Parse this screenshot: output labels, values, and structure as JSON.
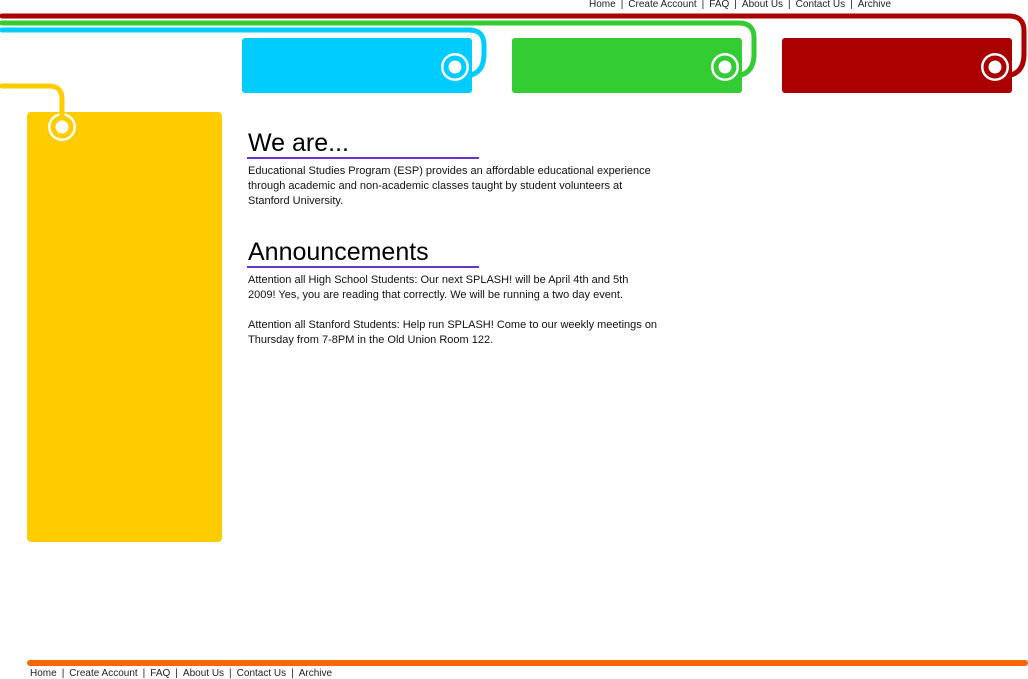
{
  "nav": {
    "items": [
      "Home",
      "Create Account",
      "FAQ",
      "About Us",
      "Contact Us",
      "Archive"
    ],
    "separator": "|"
  },
  "colors": {
    "blue": "#00ccff",
    "green": "#33cc33",
    "red": "#aa0000",
    "yellow": "#ffcc00",
    "purple": "#6633cc",
    "orange": "#ff6600"
  },
  "main": {
    "about": {
      "title": "We are...",
      "text": "Educational Studies Program (ESP) provides an affordable educational experience through academic and non-academic classes taught by student volunteers at Stanford University."
    },
    "announcements": {
      "title": "Announcements",
      "items": [
        "Attention all High School Students: Our next SPLASH! will be April 4th and 5th 2009! Yes, you are reading that correctly. We will be running a two day event.",
        "Attention all Stanford Students: Help run SPLASH! Come to our weekly meetings on Thursday from 7-8PM in the Old Union Room 122."
      ]
    }
  }
}
